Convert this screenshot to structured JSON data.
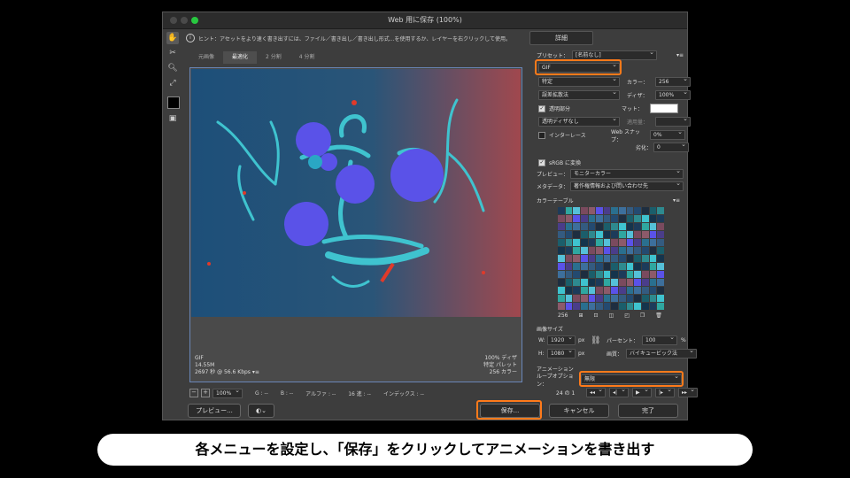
{
  "window": {
    "title": "Web 用に保存 (100%)"
  },
  "hint": {
    "text": "ヒント：アセットをより速く書き出すには、ファイル／書き出し／書き出し形式...を使用するか、レイヤーを右クリックして使用。"
  },
  "detail_button": "詳細",
  "tabs": [
    "元画像",
    "最適化",
    "2 分割",
    "4 分割"
  ],
  "canvas_info": {
    "left": [
      "GIF",
      "14.55M",
      "2697 秒 @ 56.6 Kbps"
    ],
    "right": [
      "100% ディザ",
      "特定 パレット",
      "256 カラー"
    ]
  },
  "statusbar": {
    "zoom": "100%",
    "g": "G : --",
    "b": "B : --",
    "alpha": "アルファ : --",
    "hex": "16 進 : --",
    "index": "インデックス : --"
  },
  "bottom": {
    "preview": "プレビュー...",
    "save": "保存...",
    "cancel": "キャンセル",
    "done": "完了"
  },
  "settings": {
    "preset_label": "プリセット：",
    "preset_value": "[名前なし]",
    "format": "GIF",
    "reduction": "特定",
    "colors_label": "カラー：",
    "colors": "256",
    "dither_method": "誤差拡散法",
    "dither_label": "ディザ：",
    "dither": "100%",
    "transparency": "透明部分",
    "matte_label": "マット：",
    "trans_dither": "透明ディザなし",
    "amount_label": "適用量：",
    "interlace": "インターレース",
    "websnap_label": "Web スナップ：",
    "websnap": "0%",
    "lossy_label": "劣化：",
    "lossy": "0",
    "srgb": "sRGB に変換",
    "preview_label": "プレビュー：",
    "preview_value": "モニターカラー",
    "metadata_label": "メタデータ：",
    "metadata_value": "著作権情報および問い合わせ先",
    "color_table_label": "カラーテーブル",
    "color_count": "256"
  },
  "image_size": {
    "label": "画像サイズ",
    "w_label": "W:",
    "w": "1920",
    "h_label": "H:",
    "h": "1080",
    "unit": "px",
    "percent_label": "パーセント：",
    "percent": "100",
    "percent_unit": "%",
    "quality_label": "画質：",
    "quality": "バイキュービック法"
  },
  "animation": {
    "label": "アニメーション",
    "loop_label": "ループオプション：",
    "loop_value": "無限",
    "frame": "24 の 1"
  },
  "caption": "各メニューを設定し、「保存」をクリックしてアニメーションを書き出す",
  "colors": {
    "highlight": "#ff7a1a",
    "canvas_border": "#6a86b8"
  }
}
